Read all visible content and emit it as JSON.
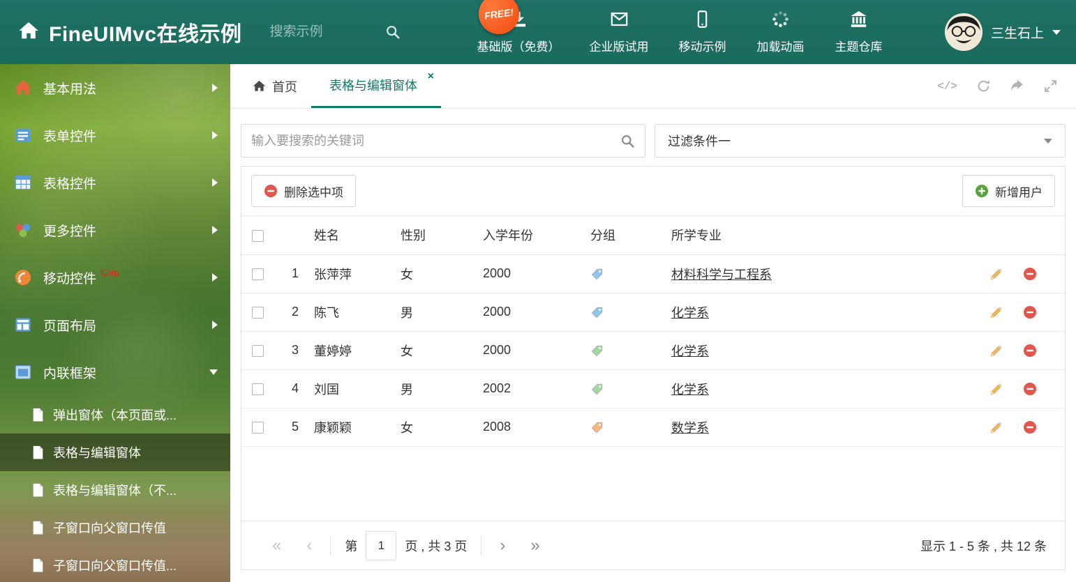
{
  "colors": {
    "header_bg": "#1e7164",
    "accent": "#0e7b69",
    "danger": "#e2574c",
    "success": "#55a53a",
    "free_badge": "#f4581d",
    "corp": "#ff1616"
  },
  "header": {
    "title": "FineUIMvc在线示例",
    "search_placeholder": "搜索示例",
    "free_badge": "FREE!",
    "nav": [
      {
        "label": "基础版（免费）"
      },
      {
        "label": "企业版试用"
      },
      {
        "label": "移动示例"
      },
      {
        "label": "加载动画"
      },
      {
        "label": "主题仓库"
      }
    ],
    "user_name": "三生石上"
  },
  "sidebar": {
    "items": [
      {
        "label": "基本用法"
      },
      {
        "label": "表单控件"
      },
      {
        "label": "表格控件"
      },
      {
        "label": "更多控件"
      },
      {
        "label": "移动控件",
        "badge": "Corp."
      },
      {
        "label": "页面布局"
      },
      {
        "label": "内联框架"
      }
    ],
    "subitems": [
      {
        "label": "弹出窗体（本页面或..."
      },
      {
        "label": "表格与编辑窗体"
      },
      {
        "label": "表格与编辑窗体（不..."
      },
      {
        "label": "子窗口向父窗口传值"
      },
      {
        "label": "子窗口向父窗口传值..."
      }
    ]
  },
  "tabs": {
    "home_label": "首页",
    "active_label": "表格与编辑窗体",
    "close_glyph": "×"
  },
  "icons": {
    "code_glyph": "</>"
  },
  "filter": {
    "search_placeholder": "输入要搜索的关键词",
    "dropdown_value": "过滤条件一"
  },
  "toolbar": {
    "delete_label": "删除选中项",
    "add_label": "新增用户"
  },
  "grid": {
    "headers": {
      "name": "姓名",
      "gender": "性别",
      "year": "入学年份",
      "group": "分组",
      "major": "所学专业"
    },
    "rows": [
      {
        "index": "1",
        "name": "张萍萍",
        "gender": "女",
        "year": "2000",
        "tag_color": "#8ec7ee",
        "major": "材料科学与工程系"
      },
      {
        "index": "2",
        "name": "陈飞",
        "gender": "男",
        "year": "2000",
        "tag_color": "#8ec7ee",
        "major": "化学系"
      },
      {
        "index": "3",
        "name": "董婷婷",
        "gender": "女",
        "year": "2000",
        "tag_color": "#a5d6a0",
        "major": "化学系"
      },
      {
        "index": "4",
        "name": "刘国",
        "gender": "男",
        "year": "2002",
        "tag_color": "#a5d6a0",
        "major": "化学系"
      },
      {
        "index": "5",
        "name": "康颖颖",
        "gender": "女",
        "year": "2008",
        "tag_color": "#f5b97f",
        "major": "数学系"
      }
    ]
  },
  "pagination": {
    "first": "«",
    "prev": "‹",
    "page_label_before": "第",
    "current_page": "1",
    "page_label_after": "页 , 共 3 页",
    "next": "›",
    "last": "»",
    "summary": "显示 1 - 5 条 , 共 12 条"
  }
}
